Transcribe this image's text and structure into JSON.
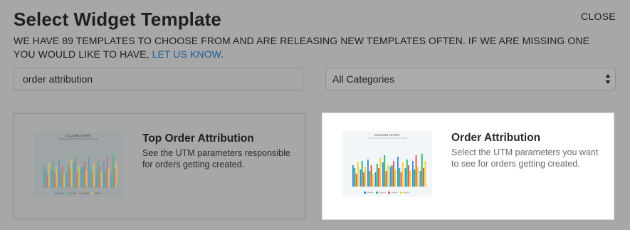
{
  "dialog": {
    "title": "Select Widget Template",
    "close_label": "CLOSE",
    "intro_text": "We have 89 templates to choose from and are releasing new templates often. If we are missing one you would like to have,",
    "intro_link": "LET US KNOW",
    "intro_end": "."
  },
  "search": {
    "value": "order attribution"
  },
  "category_select": {
    "selected": "All Categories"
  },
  "templates": [
    {
      "title": "Top Order Attribution",
      "description": "See the UTM parameters responsible for orders getting created.",
      "thumbnail_title": "COLUMN CHART",
      "highlighted": false
    },
    {
      "title": "Order Attribution",
      "description": "Select the UTM parameters you want to see for orders getting created.",
      "thumbnail_title": "COLUMN CHART",
      "highlighted": true
    }
  ],
  "colors": {
    "overlay": "#a7a7a7",
    "link": "#1d5f9b",
    "card_highlight": "#ffffff",
    "bar_blue": "#3f8fd0",
    "bar_green": "#2fb36b",
    "bar_red": "#e6524a",
    "bar_yellow": "#f2d32d"
  }
}
